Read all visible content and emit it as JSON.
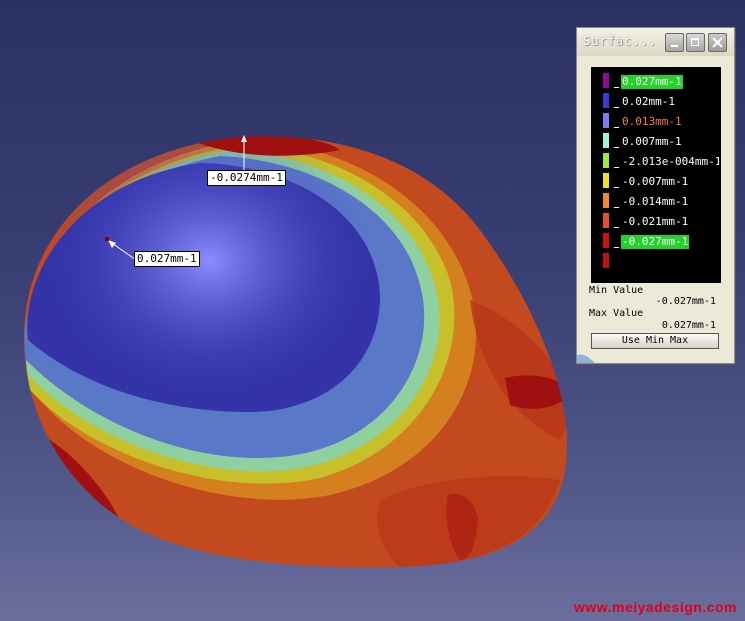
{
  "viewport": {
    "callouts": [
      {
        "name": "min-curvature-callout",
        "text": "-0.0274mm-1"
      },
      {
        "name": "max-curvature-callout",
        "text": "0.027mm-1"
      }
    ]
  },
  "dialog": {
    "title": "Surfac...",
    "legend": [
      {
        "label": "0.027mm-1",
        "color": "#8a0f96",
        "highlight": true
      },
      {
        "label": "0.02mm-1",
        "color": "#3b3bd0"
      },
      {
        "label": "0.013mm-1",
        "color": "#7a7ef0",
        "text_color": "#ff7a2e"
      },
      {
        "label": "0.007mm-1",
        "color": "#9ff0dc"
      },
      {
        "label": "-2.013e-004mm-1",
        "color": "#a6e83a"
      },
      {
        "label": "-0.007mm-1",
        "color": "#f0e020"
      },
      {
        "label": "-0.014mm-1",
        "color": "#f08a30"
      },
      {
        "label": "-0.021mm-1",
        "color": "#e05030"
      },
      {
        "label": "-0.027mm-1",
        "color": "#d01010",
        "highlight": true
      },
      {
        "label": "",
        "color": "#c01010"
      }
    ],
    "min_label": "Min Value",
    "min_value": "-0.027mm-1",
    "max_label": "Max Value",
    "max_value": "0.027mm-1",
    "button_label": "Use Min Max"
  },
  "watermark": "www.meiyadesign.com"
}
